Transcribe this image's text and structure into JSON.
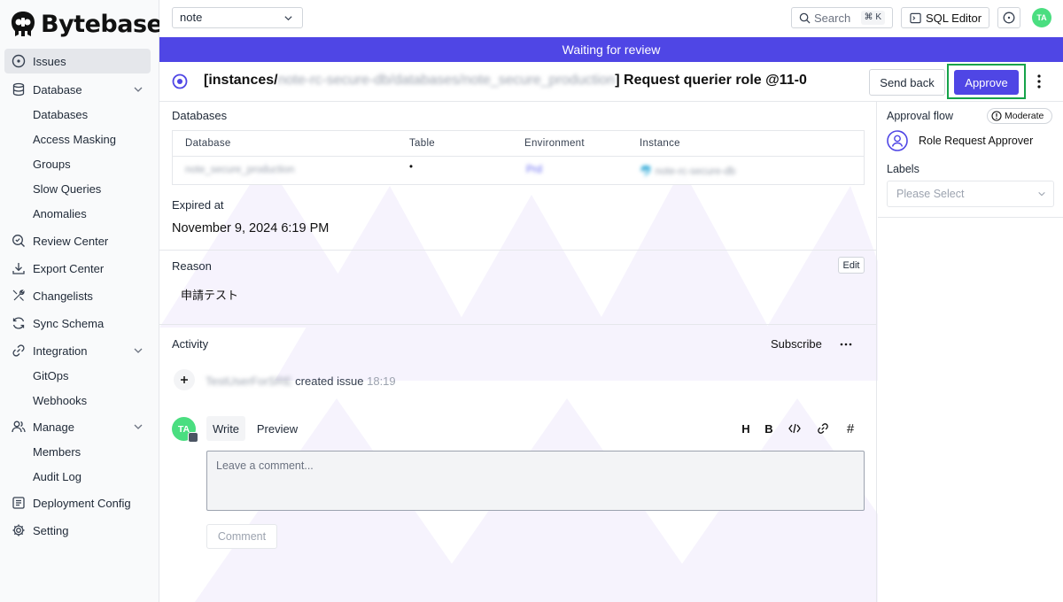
{
  "sidebar": {
    "brand": "Bytebase",
    "items": [
      {
        "label": "Issues",
        "icon": "circle-dot-icon"
      },
      {
        "label": "Database",
        "icon": "database-icon"
      },
      {
        "label": "Databases"
      },
      {
        "label": "Access Masking"
      },
      {
        "label": "Groups"
      },
      {
        "label": "Slow Queries"
      },
      {
        "label": "Anomalies"
      },
      {
        "label": "Review Center",
        "icon": "search-check-icon"
      },
      {
        "label": "Export Center",
        "icon": "download-icon"
      },
      {
        "label": "Changelists",
        "icon": "tools-icon"
      },
      {
        "label": "Sync Schema",
        "icon": "refresh-icon"
      },
      {
        "label": "Integration",
        "icon": "link-icon"
      },
      {
        "label": "GitOps"
      },
      {
        "label": "Webhooks"
      },
      {
        "label": "Manage",
        "icon": "users-icon"
      },
      {
        "label": "Members"
      },
      {
        "label": "Audit Log"
      },
      {
        "label": "Deployment Config",
        "icon": "list-icon"
      },
      {
        "label": "Setting",
        "icon": "gear-icon"
      }
    ]
  },
  "topbar": {
    "project": "note",
    "search_label": "Search",
    "search_shortcut": "⌘ K",
    "sql_editor": "SQL Editor",
    "avatar": "TA"
  },
  "banner": "Waiting for review",
  "issue": {
    "title_prefix": "[instances/",
    "title_blurred": "note-rc-secure-db/databases/note_secure_production",
    "title_suffix": "] Request querier role @11-0",
    "send_back": "Send back",
    "approve": "Approve"
  },
  "databases": {
    "label": "Databases",
    "columns": [
      "Database",
      "Table",
      "Environment",
      "Instance"
    ],
    "row": {
      "database": "note_secure_production",
      "table": "•",
      "environment": "Prd",
      "instance": "note-rc-secure-db"
    }
  },
  "expired": {
    "label": "Expired at",
    "value": "November 9, 2024 6:19 PM"
  },
  "reason": {
    "label": "Reason",
    "edit": "Edit",
    "text": "申請テスト"
  },
  "activity": {
    "label": "Activity",
    "subscribe": "Subscribe",
    "user": "TestUserForSRE",
    "action": "created issue",
    "time": "18:19",
    "avatar": "TA",
    "tab_write": "Write",
    "tab_preview": "Preview",
    "tools": [
      "H",
      "B",
      "</>",
      "link",
      "#"
    ],
    "placeholder": "Leave a comment...",
    "comment_button": "Comment"
  },
  "right_panel": {
    "approval_flow_label": "Approval flow",
    "risk": "Moderate",
    "approver": "Role Request Approver",
    "labels_label": "Labels",
    "labels_placeholder": "Please Select"
  },
  "colors": {
    "accent": "#4f46e5",
    "highlight": "#16a34a",
    "avatar": "#4ade80"
  }
}
